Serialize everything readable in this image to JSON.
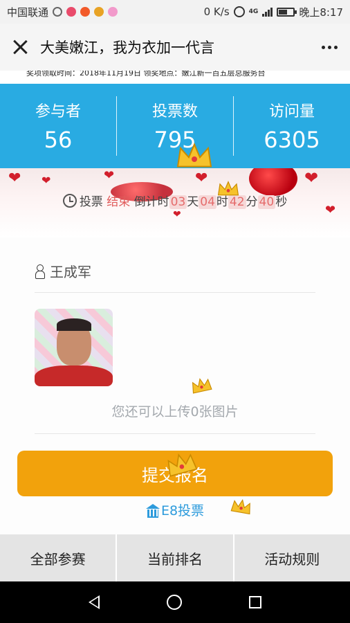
{
  "status_bar": {
    "carrier": "中国联通",
    "speed": "0 K/s",
    "network": "4G",
    "battery_level": 0.55,
    "time": "晚上8:17"
  },
  "title_bar": {
    "title": "大美嫩江，我为衣加一代言"
  },
  "notice": {
    "text": "奖项领取时间：2018年11月19日    领奖地点：嫩江新一百五层总服务台"
  },
  "stats": [
    {
      "label": "参与者",
      "value": "56"
    },
    {
      "label": "投票数",
      "value": "795"
    },
    {
      "label": "访问量",
      "value": "6305"
    }
  ],
  "countdown": {
    "prefix": "投票",
    "status": "结束",
    "middle": "倒计时",
    "days": "03",
    "days_unit": "天",
    "hours": "04",
    "hours_unit": "时",
    "minutes": "42",
    "minutes_unit": "分",
    "seconds": "40",
    "seconds_unit": "秒"
  },
  "form": {
    "name": "王成军",
    "upload_hint": "您还可以上传0张图片",
    "submit_label": "提交报名",
    "footer_link": "E8投票"
  },
  "tabs": [
    {
      "label": "全部参赛"
    },
    {
      "label": "当前排名"
    },
    {
      "label": "活动规则"
    }
  ],
  "colors": {
    "stats_bg": "#29abe2",
    "submit_bg": "#f2a20c",
    "link": "#2d9bdc",
    "countdown_highlight": "#e56b6b"
  }
}
